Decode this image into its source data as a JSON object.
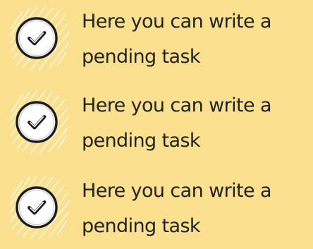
{
  "colors": {
    "background": "#fbe18f",
    "text": "#222222",
    "badge_fill": "#ffffff",
    "badge_outline": "#1c1c1c"
  },
  "tasks": [
    {
      "icon": "check-circle-icon",
      "text": "Here you can write a pending task"
    },
    {
      "icon": "check-circle-icon",
      "text": "Here you can write a pending task"
    },
    {
      "icon": "check-circle-icon",
      "text": "Here you can write a pending task"
    }
  ]
}
